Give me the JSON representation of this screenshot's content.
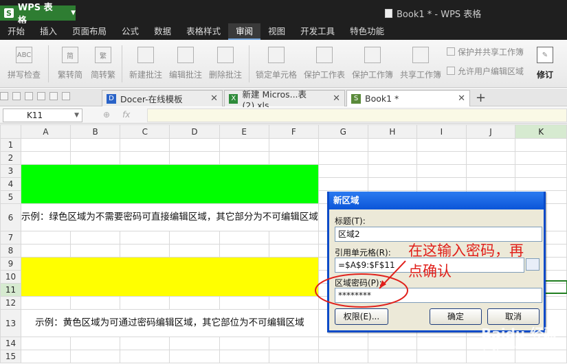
{
  "app": {
    "menu_label": "WPS 表格",
    "window_title": "Book1 * - WPS 表格"
  },
  "menu": [
    "开始",
    "插入",
    "页面布局",
    "公式",
    "数据",
    "表格样式",
    "审阅",
    "视图",
    "开发工具",
    "特色功能"
  ],
  "ribbon": {
    "spellcheck": "拼写检查",
    "trad": "繁转简",
    "simp": "简转繁",
    "new_comment": "新建批注",
    "edit_comment": "编辑批注",
    "delete_comment": "删除批注",
    "lock_cell": "锁定单元格",
    "protect_sheet": "保护工作表",
    "protect_book": "保护工作簿",
    "share_book": "共享工作簿",
    "protect_share": "保护并共享工作簿",
    "allow_edit": "允许用户编辑区域",
    "revise": "修订"
  },
  "tabs": [
    "Docer-在线模板",
    "新建 Micros...表 (2).xls",
    "Book1 *"
  ],
  "namebox": "K11",
  "columns": [
    "A",
    "B",
    "C",
    "D",
    "E",
    "F",
    "G",
    "H",
    "I",
    "J",
    "K"
  ],
  "rows": [
    "1",
    "2",
    "3",
    "4",
    "5",
    "6",
    "7",
    "8",
    "9",
    "10",
    "11",
    "12",
    "13",
    "14",
    "15"
  ],
  "notes": {
    "green": "示例：绿色区域为不需要密码可直接编辑区域，其它部分为不可编辑区域",
    "yellow": "示例：黄色区域为可通过密码编辑区域，其它部位为不可编辑区域"
  },
  "dialog": {
    "title": "新区域",
    "title_label": "标题(T):",
    "title_value": "区域2",
    "ref_label": "引用单元格(R):",
    "ref_value": "=$A$9:$F$11",
    "pwd_label": "区域密码(P):",
    "pwd_value": "********",
    "perm_btn": "权限(E)...",
    "ok_btn": "确定",
    "cancel_btn": "取消"
  },
  "annotation": {
    "line1": "在这输入密码，再",
    "line2": "点确认"
  },
  "watermark": {
    "brand": "Baidu 经验",
    "url": "jingyan.baidu.com"
  }
}
